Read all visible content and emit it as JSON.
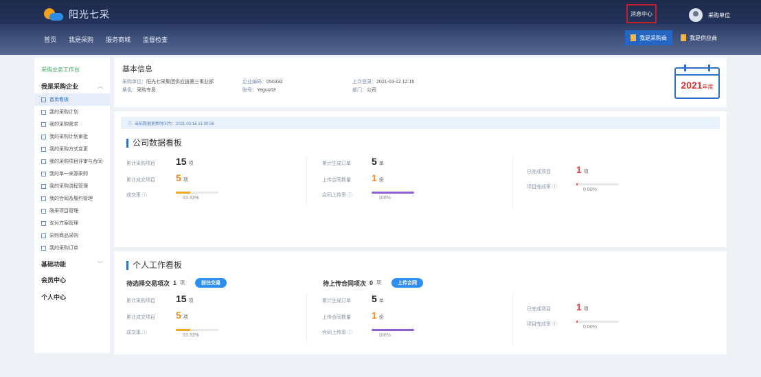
{
  "header": {
    "logo_text": "阳光七采",
    "nav": [
      "首页",
      "我是采购",
      "服务商城",
      "监督检查"
    ],
    "message_button": "消息中心",
    "user_name": "采购单位",
    "role_buyer": "我是采购商",
    "role_seller": "我是供应商"
  },
  "sidebar": {
    "title": "采购业务工作台",
    "group1": "我是采购企业",
    "items": [
      "首页看板",
      "我的采购计划",
      "我的采购需求",
      "我的采购计划审批",
      "我的采购方式变更",
      "我的采购项目评审与合同",
      "我的单一来源采购",
      "我的采购流程管理",
      "我的合同及履约管理",
      "政采项目管理",
      "支付方案管理",
      "采购商品采购",
      "我的采购订单"
    ],
    "group2": "基础功能",
    "plain1": "会员中心",
    "plain2": "个人中心"
  },
  "info": {
    "title": "基本信息",
    "company_label": "采购单位：",
    "company_value": "阳光七采集团供应链第三事业部",
    "login_label": "企业编码：",
    "login_value": "050333",
    "time_label": "上次登录：",
    "time_value": "2021-03-12 12:16",
    "role_label": "角色：",
    "role_value": "采购专员",
    "account_label": "账号：",
    "account_value": "Yeguo03",
    "dept_label": "部门：",
    "dept_value": "公司",
    "year": "2021",
    "year_suffix": "年度"
  },
  "company": {
    "note": "当前数据更新时间为：2021-03-15 21:00:56",
    "title": "公司数据看板",
    "total_projects_label": "累计采购项目",
    "total_projects": "15",
    "total_projects_unit": "项",
    "done_projects_label": "累计成交项目",
    "done_projects": "5",
    "done_projects_unit": "项",
    "deal_rate_label": "成交率",
    "deal_rate_pct": "33.33%",
    "deal_rate": 0.3333,
    "orders_label": "累计生成订单",
    "orders": "5",
    "orders_unit": "单",
    "contracts_label": "上传合同数量",
    "contracts": "1",
    "contracts_unit": "份",
    "contract_rate_label": "合同上传率",
    "contract_rate_pct": "100%",
    "contract_rate": 1.0,
    "finished_label": "已完成项目",
    "finished": "1",
    "finished_unit": "项",
    "complete_rate_label": "项目完成率",
    "complete_rate_pct": "0.00%",
    "complete_rate": 0.0
  },
  "personal": {
    "title": "个人工作看板",
    "todo1_label": "待选择交易项次",
    "todo1_count": "1",
    "todo1_unit": "项",
    "todo1_button": "前往交易",
    "todo2_label": "待上传合同项次",
    "todo2_count": "0",
    "todo2_unit": "项",
    "todo2_button": "上传合同",
    "total_projects_label": "累计采购项目",
    "total_projects": "15",
    "total_projects_unit": "项",
    "done_projects_label": "累计成交项目",
    "done_projects": "5",
    "done_projects_unit": "项",
    "deal_rate_label": "成交率",
    "deal_rate_pct": "33.33%",
    "deal_rate": 0.3333,
    "orders_label": "累计生成订单",
    "orders": "5",
    "orders_unit": "单",
    "contracts_label": "上传合同数量",
    "contracts": "1",
    "contracts_unit": "份",
    "contract_rate_label": "合同上传率",
    "contract_rate_pct": "100%",
    "contract_rate": 1.0,
    "finished_label": "已完成项目",
    "finished": "1",
    "finished_unit": "项",
    "complete_rate_label": "项目完成率",
    "complete_rate_pct": "0.00%",
    "complete_rate": 0.0
  },
  "colors": {
    "accent": "#2c6fcf",
    "deal_bar": "#f5a623",
    "contract_bar": "#8c5fd6",
    "complete_bar": "#e13a3a"
  }
}
